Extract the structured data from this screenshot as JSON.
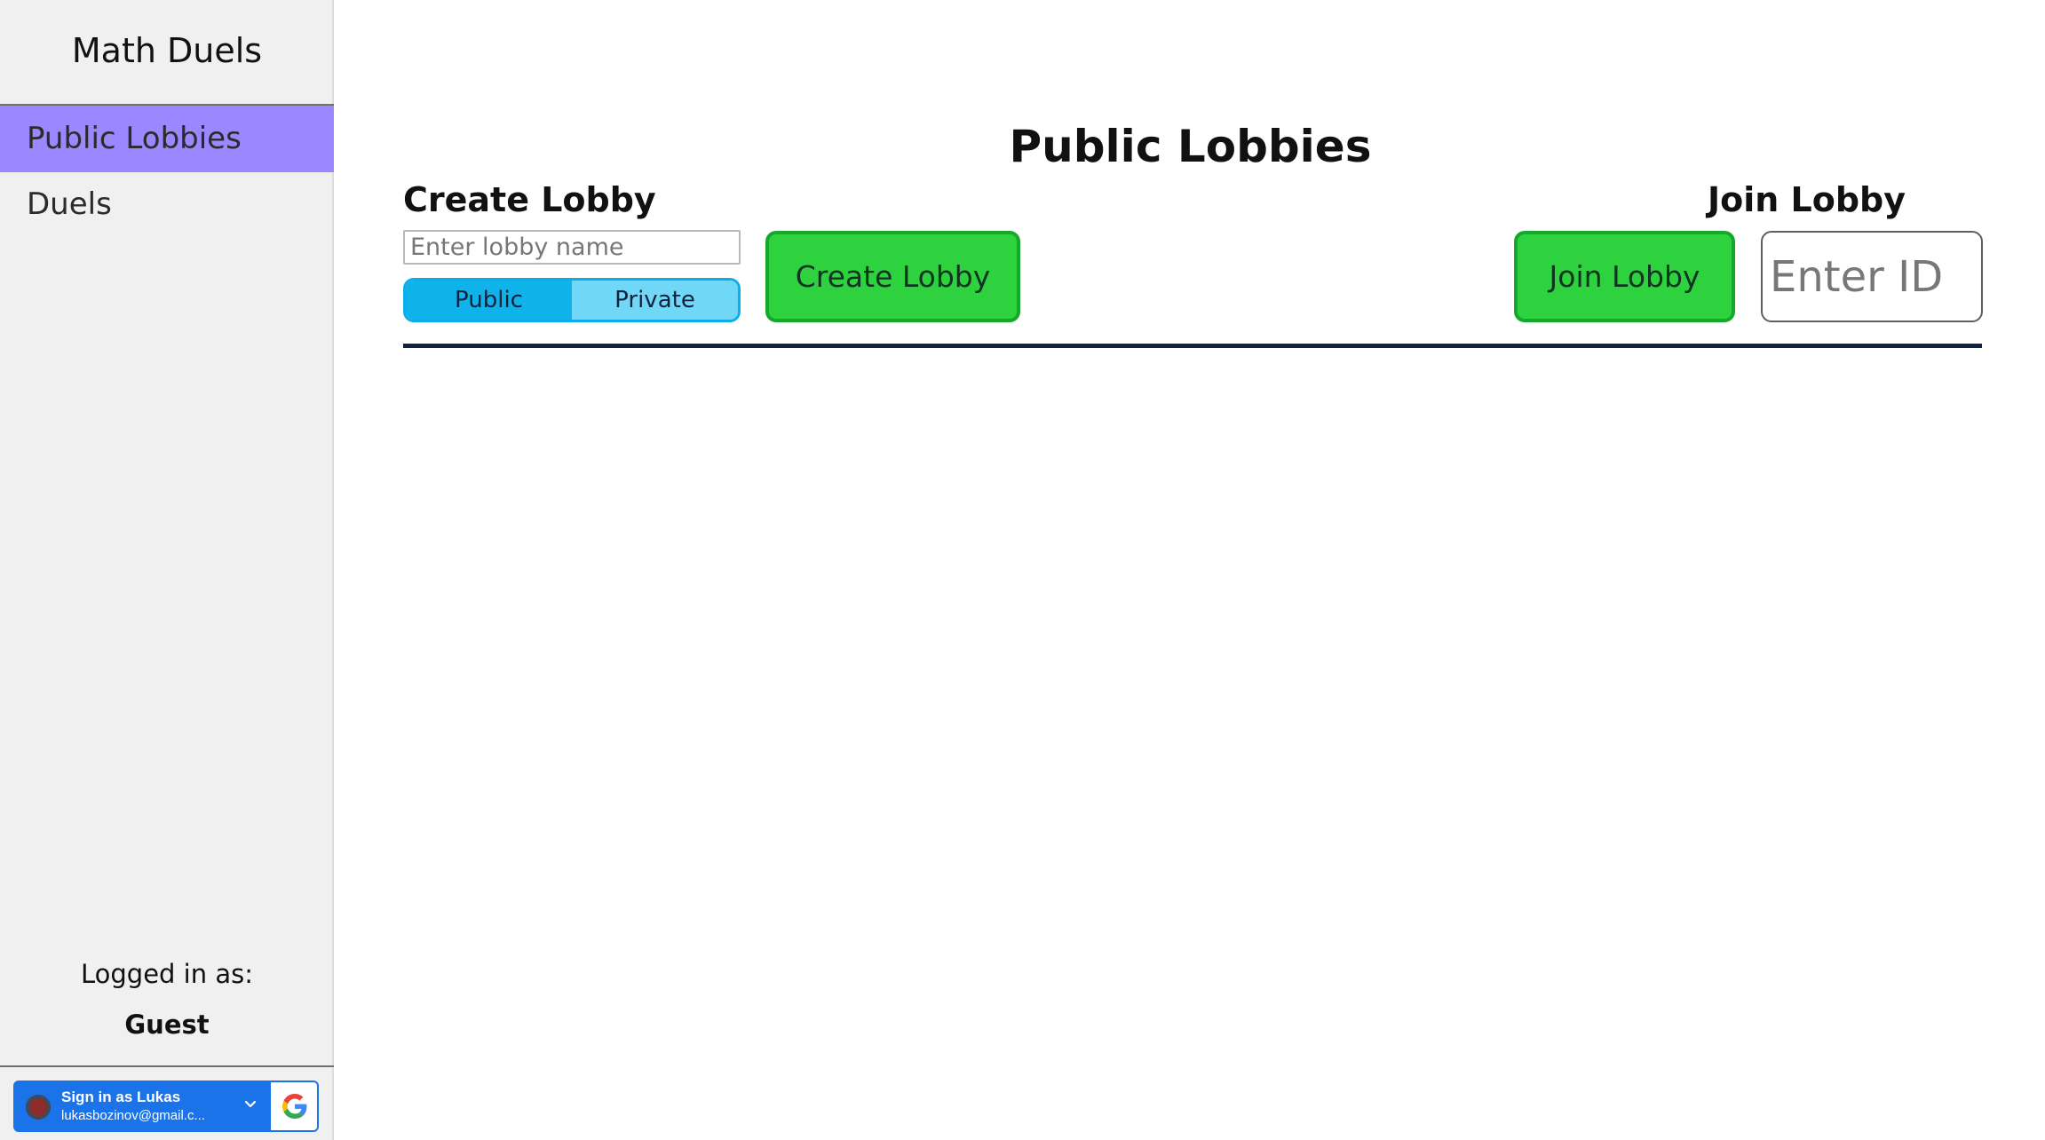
{
  "sidebar": {
    "brand": "Math Duels",
    "items": [
      {
        "label": "Public Lobbies",
        "active": true
      },
      {
        "label": "Duels",
        "active": false
      }
    ],
    "login_label": "Logged in as:",
    "user": "Guest",
    "google": {
      "name": "Sign in as Lukas",
      "email": "lukasbozinov@gmail.c...",
      "icon": "google-logo"
    }
  },
  "main": {
    "title": "Public Lobbies",
    "create": {
      "heading": "Create Lobby",
      "name_placeholder": "Enter lobby name",
      "visibility": {
        "options": [
          "Public",
          "Private"
        ],
        "selected": "Public"
      },
      "button_label": "Create Lobby"
    },
    "join": {
      "heading": "Join Lobby",
      "button_label": "Join Lobby",
      "id_placeholder": "Enter ID"
    }
  },
  "colors": {
    "sidebar_background": "#f0f0f0",
    "active_nav": "#9b87ff",
    "action_green": "#2ed23e",
    "toggle_selected": "#10b2ea",
    "toggle_unselected": "#70d7f7",
    "divider": "#10233e",
    "google_blue": "#1a73e8"
  }
}
